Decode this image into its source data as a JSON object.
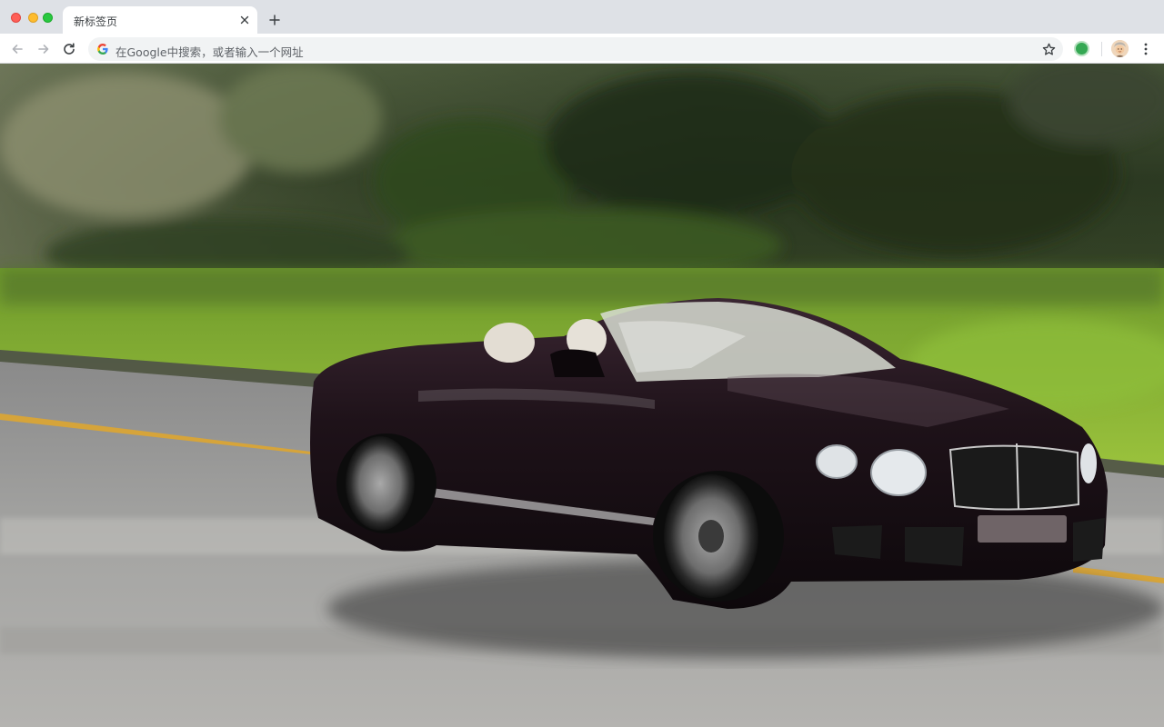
{
  "window": {
    "tab_title": "新标签页",
    "icons": {
      "close": "close-icon",
      "new_tab": "plus-icon"
    }
  },
  "toolbar": {
    "address_placeholder": "在Google中搜索，或者输入一个网址",
    "icons": {
      "back": "arrow-left-icon",
      "forward": "arrow-right-icon",
      "reload": "reload-icon",
      "search_engine": "google-g-icon",
      "bookmark": "star-icon",
      "extension": "green-circle-extension-icon",
      "profile": "avatar-icon",
      "menu": "kebab-menu-icon"
    }
  },
  "wallpaper": {
    "description_visible": false
  },
  "colors": {
    "tabstrip_bg": "#dee1e6",
    "toolbar_bg": "#ffffff",
    "omnibox_bg": "#f1f3f4",
    "extension_green": "#34a853"
  }
}
